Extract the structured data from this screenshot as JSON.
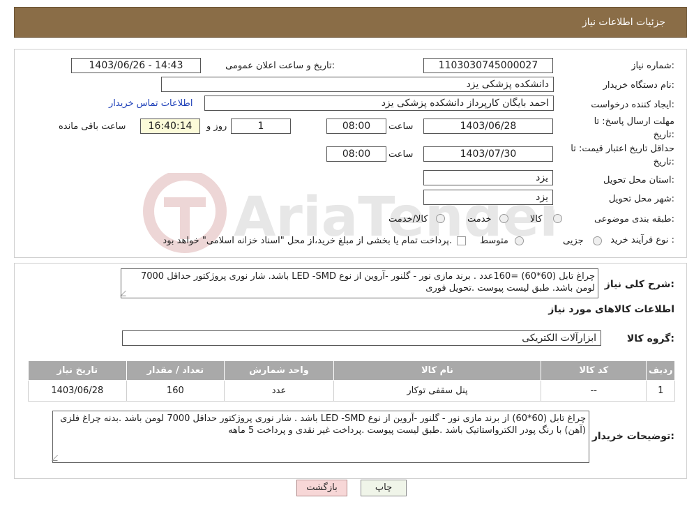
{
  "header": {
    "title": "جزئیات اطلاعات نیاز"
  },
  "form": {
    "need_number_label": "شماره نیاز:",
    "need_number": "1103030745000027",
    "announce_label": "تاریخ و ساعت اعلان عمومی:",
    "announce_value": "1403/06/26 - 14:43",
    "buyer_org_label": "نام دستگاه خریدار:",
    "buyer_org": "دانشکده پزشکی  یزد",
    "requester_label": "ایجاد کننده درخواست:",
    "requester": "احمد بایگان کارپرداز دانشکده پزشکی  یزد",
    "contact_link": "اطلاعات تماس خریدار",
    "deadline_label_1": "مهلت ارسال پاسخ: تا",
    "deadline_label_2": "تاریخ:",
    "deadline_date": "1403/06/28",
    "time_label": "ساعت",
    "deadline_time": "08:00",
    "days_value": "1",
    "days_label": "روز و",
    "remaining_time": "16:40:14",
    "remaining_label": "ساعت باقی مانده",
    "validity_label_1": "حداقل تاریخ اعتبار قیمت: تا",
    "validity_label_2": "تاریخ:",
    "validity_date": "1403/07/30",
    "validity_time": "08:00",
    "province_label": "استان محل تحویل:",
    "province": "یزد",
    "city_label": "شهر محل تحویل:",
    "city": "یزد",
    "category_label": "طبقه بندی موضوعی:",
    "category_options": [
      "کالا",
      "خدمت",
      "کالا/خدمت"
    ],
    "process_label": "نوع فرآیند خرید :",
    "process_options": [
      "جزیی",
      "متوسط"
    ],
    "process_note": "پرداخت تمام یا بخشی از مبلغ خرید،از محل \"اسناد خزانه اسلامی\" خواهد بود."
  },
  "details": {
    "summary_label": "شرح کلی نیاز:",
    "summary_text": "چراغ تابل (60*60)  =160عدد . برند مازی نور  - گلنور  -آروین از نوع LED -SMD باشد. شار نوری پروژکتور حداقل 7000 لومن باشد. طبق لیست پیوست .تحویل فوری",
    "goods_info_title": "اطلاعات کالاهای مورد نیاز",
    "goods_group_label": "گروه کالا:",
    "goods_group": "ابزارآلات الکتریکی",
    "table": {
      "headers": [
        "ردیف",
        "کد کالا",
        "نام کالا",
        "واحد شمارش",
        "تعداد / مقدار",
        "تاریخ نیاز"
      ],
      "rows": [
        [
          "1",
          "--",
          "پنل سقفی توکار",
          "عدد",
          "160",
          "1403/06/28"
        ]
      ]
    },
    "buyer_notes_label": "توضیحات خریدار:",
    "buyer_notes": "چراغ تابل (60*60) از برند مازی نور  - گلنور  -آروین از نوع LED -SMD باشد . شار نوری پروژکتور حداقل 7000 لومن باشد .بدنه چراغ فلزی (آهن) با رنگ پودر الکترواستاتیک باشد .طبق لیست پیوست .پرداخت غیر نقدی و پرداخت 5 ماهه"
  },
  "buttons": {
    "print": "چاپ",
    "back": "بازگشت"
  },
  "watermark": {
    "text": "AriaTender.neT"
  }
}
